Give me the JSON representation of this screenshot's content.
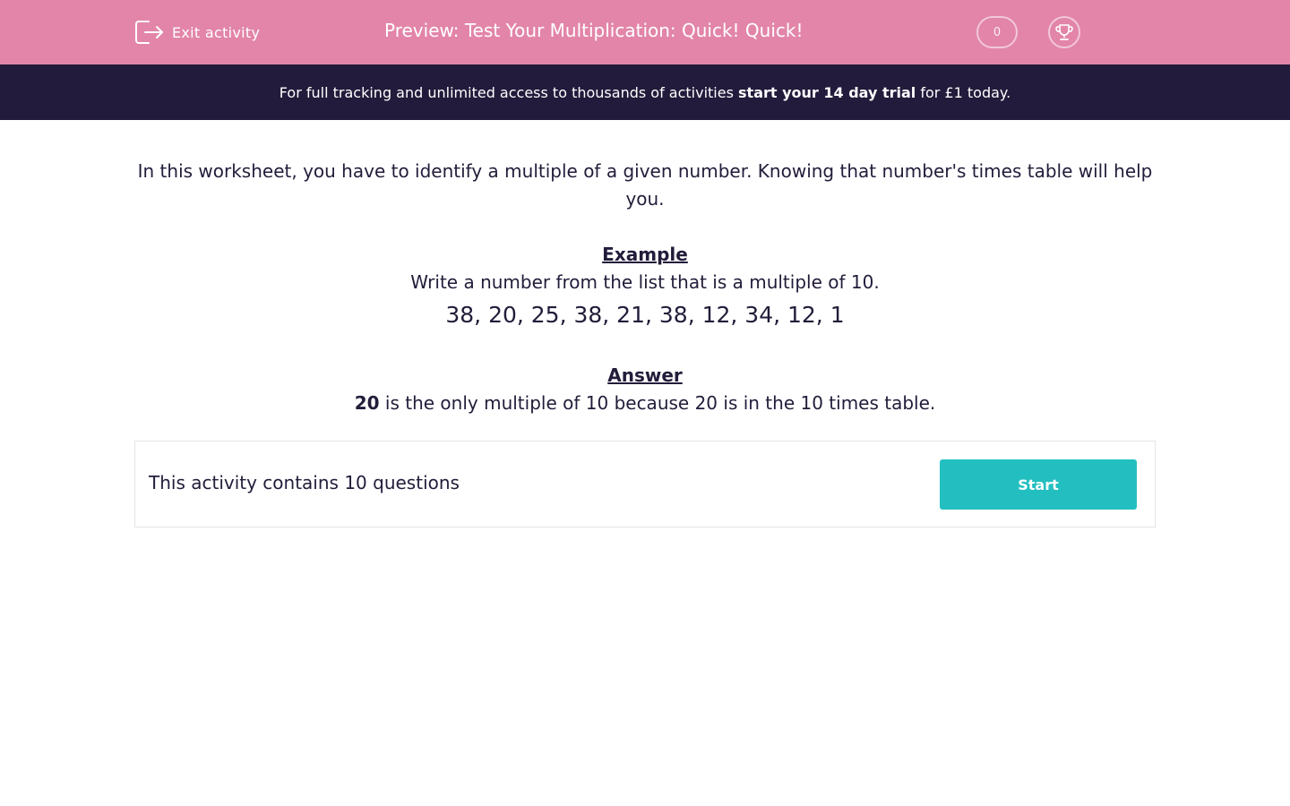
{
  "header": {
    "exit_label": "Exit activity",
    "title": "Preview: Test Your Multiplication: Quick! Quick!",
    "score": "0",
    "exit_icon": "exit-icon",
    "trophy_icon": "trophy-icon"
  },
  "banner": {
    "text_before": "For full tracking and unlimited access to thousands of activities ",
    "link_text": "start your 14 day trial",
    "text_after": " for £1 today."
  },
  "content": {
    "intro": "In this worksheet, you have to identify a multiple of a given number. Knowing that number's times table will help you.",
    "example_heading": "Example",
    "question": "Write a number from the list that is a multiple of 10.",
    "number_list": "38, 20, 25, 38, 21, 38, 12, 34, 12, 1",
    "answer_heading": "Answer",
    "answer_bold": "20",
    "answer_rest": " is the only multiple of 10 because 20 is in the 10 times table."
  },
  "activity": {
    "info": "This activity contains 10 questions",
    "start_label": "Start"
  },
  "colors": {
    "header_bg": "#e285a8",
    "banner_bg": "#231b3b",
    "start_button": "#23bfc0",
    "text": "#231c3a"
  }
}
